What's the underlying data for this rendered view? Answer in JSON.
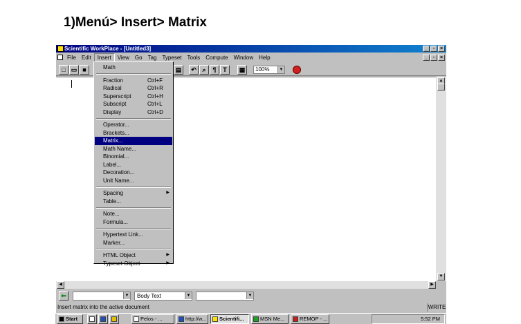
{
  "heading": "1)Menú> Insert> Matrix",
  "window": {
    "title": "Scientific WorkPlace - [Untitled3]",
    "title_buttons": [
      "_",
      "8",
      "x"
    ],
    "menubar": [
      "File",
      "Edit",
      "Insert",
      "View",
      "Go",
      "Tag",
      "Typeset",
      "Tools",
      "Compute",
      "Window",
      "Help"
    ],
    "zoom": "100%"
  },
  "insert_menu": {
    "groups": [
      [
        {
          "label": "Math"
        }
      ],
      [
        {
          "label": "Fraction",
          "shortcut": "Ctrl+F"
        },
        {
          "label": "Radical",
          "shortcut": "Ctrl+R"
        },
        {
          "label": "Superscript",
          "shortcut": "Ctrl+H"
        },
        {
          "label": "Subscript",
          "shortcut": "Ctrl+L"
        },
        {
          "label": "Display",
          "shortcut": "Ctrl+D"
        }
      ],
      [
        {
          "label": "Operator..."
        },
        {
          "label": "Brackets..."
        },
        {
          "label": "Matrix...",
          "highlighted": true
        },
        {
          "label": "Math Name..."
        },
        {
          "label": "Binomial..."
        },
        {
          "label": "Label..."
        },
        {
          "label": "Decoration..."
        },
        {
          "label": "Unit Name..."
        }
      ],
      [
        {
          "label": "Spacing",
          "submenu": true
        },
        {
          "label": "Table..."
        }
      ],
      [
        {
          "label": "Note..."
        },
        {
          "label": "Formula..."
        }
      ],
      [
        {
          "label": "Hypertext Link..."
        },
        {
          "label": "Marker..."
        }
      ],
      [
        {
          "label": "HTML Object",
          "submenu": true
        },
        {
          "label": "Typeset Object",
          "submenu": true
        }
      ]
    ]
  },
  "bottom_toolbar": {
    "tag_combo_1": "",
    "tag_combo_2": "Body Text",
    "tag_combo_3": ""
  },
  "status": {
    "message": "Insert matrix into the active document",
    "mode": "WRITE"
  },
  "taskbar": {
    "start": "Start",
    "tasks": [
      {
        "label": "Pelos - ..."
      },
      {
        "label": "http://w..."
      },
      {
        "label": "Scientifi...",
        "active": true
      },
      {
        "label": "MSN Me..."
      },
      {
        "label": "REMOP - ..."
      }
    ],
    "clock": "5:52 PM"
  },
  "colors": {
    "titlebar": "#000080",
    "highlight": "#000080",
    "chrome": "#c0c0c0"
  }
}
